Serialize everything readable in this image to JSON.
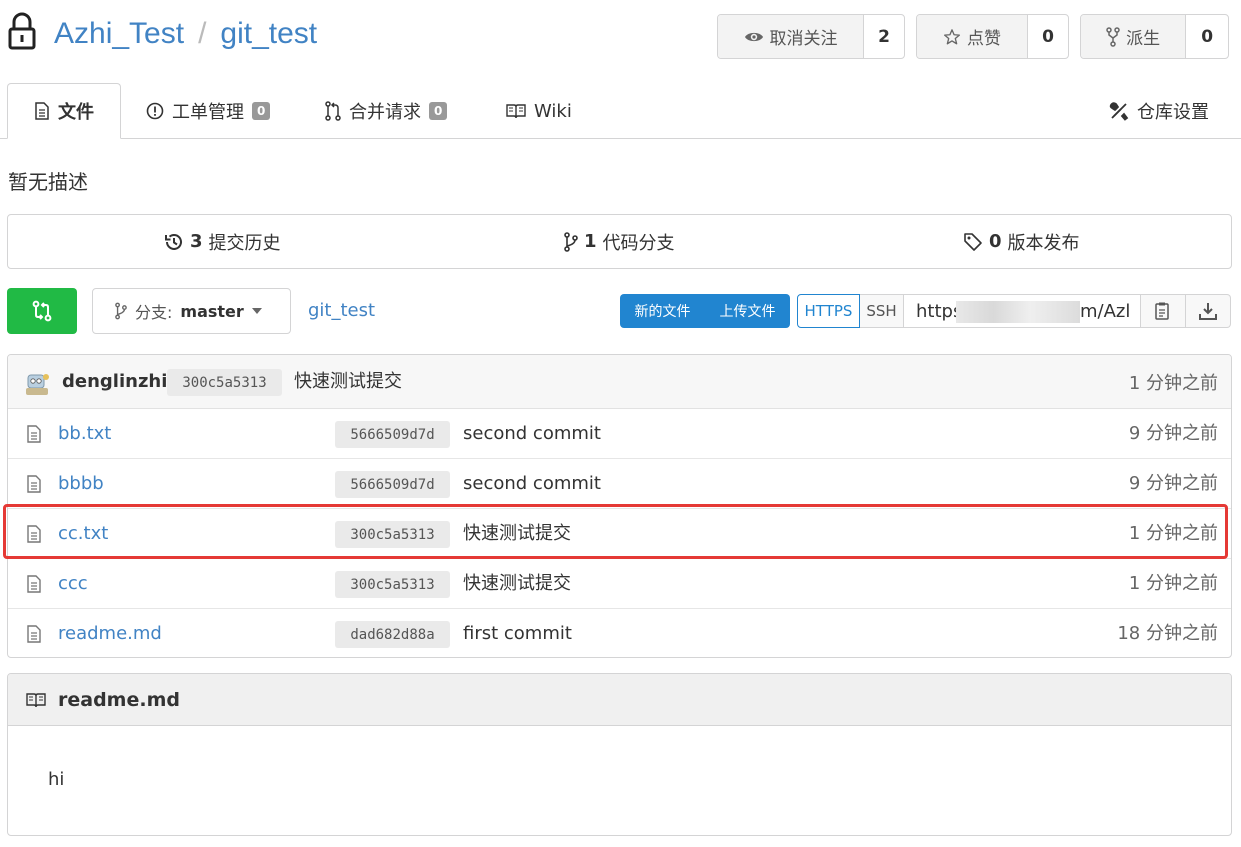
{
  "repo": {
    "owner": "Azhi_Test",
    "separator": "/",
    "name": "git_test"
  },
  "header_actions": [
    {
      "icon": "eye-icon",
      "label": "取消关注",
      "count": "2"
    },
    {
      "icon": "star-icon",
      "label": "点赞",
      "count": "0"
    },
    {
      "icon": "fork-icon",
      "label": "派生",
      "count": "0"
    }
  ],
  "tabs": {
    "files": "文件",
    "issues": "工单管理",
    "issues_count": "0",
    "pulls": "合并请求",
    "pulls_count": "0",
    "wiki": "Wiki",
    "settings": "仓库设置"
  },
  "description": "暂无描述",
  "stats": {
    "commits_count": "3",
    "commits_label": "提交历史",
    "branches_count": "1",
    "branches_label": "代码分支",
    "releases_count": "0",
    "releases_label": "版本发布"
  },
  "toolbar": {
    "branch_prefix": "分支:",
    "branch_name": "master",
    "breadcrumb": "git_test",
    "new_file": "新的文件",
    "upload_file": "上传文件",
    "https": "HTTPS",
    "ssh": "SSH",
    "clone_url_start": "https",
    "clone_url_end": "m/Azl"
  },
  "latest_commit": {
    "author": "denglinzhi",
    "sha": "300c5a5313",
    "message": "快速测试提交",
    "time": "1 分钟之前"
  },
  "files": [
    {
      "name": "bb.txt",
      "sha": "5666509d7d",
      "message": "second commit",
      "time": "9 分钟之前"
    },
    {
      "name": "bbbb",
      "sha": "5666509d7d",
      "message": "second commit",
      "time": "9 分钟之前"
    },
    {
      "name": "cc.txt",
      "sha": "300c5a5313",
      "message": "快速测试提交",
      "time": "1 分钟之前"
    },
    {
      "name": "ccc",
      "sha": "300c5a5313",
      "message": "快速测试提交",
      "time": "1 分钟之前"
    },
    {
      "name": "readme.md",
      "sha": "dad682d88a",
      "message": "first commit",
      "time": "18 分钟之前"
    }
  ],
  "readme": {
    "title": "readme.md",
    "content": "hi"
  },
  "colors": {
    "accent": "#4183c4",
    "primary": "#2185d0",
    "green": "#21ba45",
    "highlight": "#e53935"
  }
}
